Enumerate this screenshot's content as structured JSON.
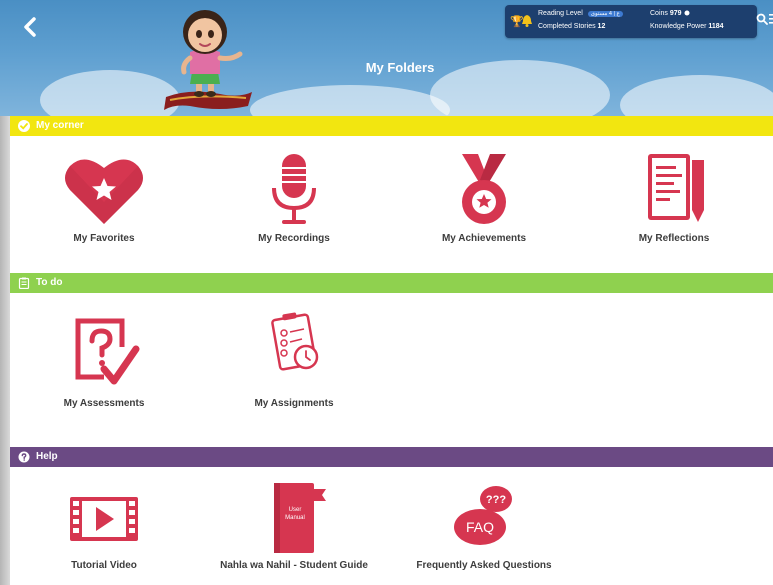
{
  "header": {
    "title": "My Folders",
    "stats": {
      "reading_level_label": "Reading Level",
      "reading_level_value": "ع | 4 مستوى",
      "completed_stories_label": "Completed Stories",
      "completed_stories_value": "12",
      "coins_label": "Coins",
      "coins_value": "979",
      "knowledge_power_label": "Knowledge Power",
      "knowledge_power_value": "1184"
    }
  },
  "sections": {
    "my_corner": {
      "title": "My corner",
      "color": "#f2e610",
      "items": [
        "My Favorites",
        "My Recordings",
        "My Achievements",
        "My Reflections"
      ]
    },
    "to_do": {
      "title": "To do",
      "color": "#8fd14f",
      "items": [
        "My Assessments",
        "My Assignments"
      ]
    },
    "help": {
      "title": "Help",
      "color": "#6b4a84",
      "items": [
        "Tutorial Video",
        "Nahla wa Nahil - Student Guide",
        "Frequently Asked Questions"
      ],
      "manual_cover_text": [
        "User",
        "Manual"
      ],
      "faq_badge_text": "FAQ"
    }
  },
  "colors": {
    "accent": "#d63650",
    "header_blue": "#5e9fd0",
    "stats_panel": "#1d3f6e"
  }
}
